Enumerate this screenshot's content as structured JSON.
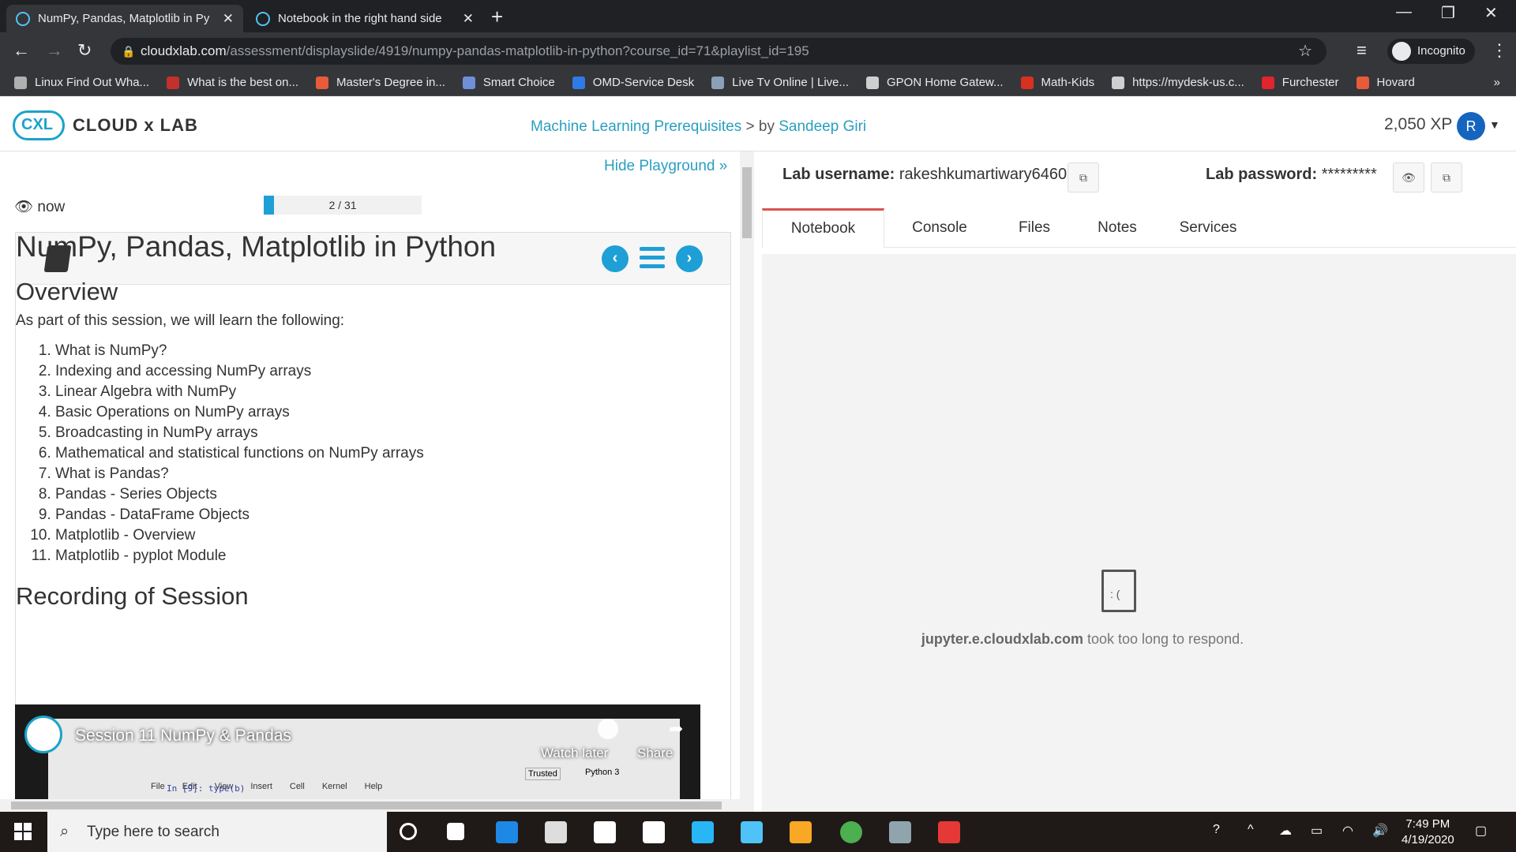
{
  "browser": {
    "tabs": [
      {
        "title": "NumPy, Pandas, Matplotlib in Py",
        "active": true
      },
      {
        "title": "Notebook in the right hand side",
        "active": false
      }
    ],
    "url_host": "cloudxlab.com",
    "url_path": "/assessment/displayslide/4919/numpy-pandas-matplotlib-in-python?course_id=71&playlist_id=195",
    "incognito_label": "Incognito",
    "bookmarks": [
      {
        "label": "Linux Find Out Wha...",
        "color": "#b0b0b0"
      },
      {
        "label": "What is the best on...",
        "color": "#c4302b"
      },
      {
        "label": "Master's Degree in...",
        "color": "#e85b3a"
      },
      {
        "label": "Smart Choice",
        "color": "#6f8fd8"
      },
      {
        "label": "OMD-Service Desk",
        "color": "#2f7be5"
      },
      {
        "label": "Live Tv Online | Live...",
        "color": "#8aa0b8"
      },
      {
        "label": "GPON Home Gatew...",
        "color": "#cfcfcf"
      },
      {
        "label": "Math-Kids",
        "color": "#d9301f"
      },
      {
        "label": "https://mydesk-us.c...",
        "color": "#cfcfcf"
      },
      {
        "label": "Furchester",
        "color": "#e0252e"
      },
      {
        "label": "Hovard",
        "color": "#e85b3a"
      }
    ]
  },
  "header": {
    "logo_text": "CLOUD x LAB",
    "logo_mark": "CXL",
    "course": "Machine Learning Prerequisites",
    "separator": " > by ",
    "author": "Sandeep Giri",
    "xp": "2,050 XP",
    "avatar": "R"
  },
  "left": {
    "hide_playground": "Hide Playground »",
    "views": "now",
    "progress_label": "2 / 31",
    "progress_fraction": 0.065,
    "title": "NumPy, Pandas, Matplotlib in Python",
    "overview_heading": "Overview",
    "intro": "As part of this session, we will learn the following:",
    "items": [
      "What is NumPy?",
      "Indexing and accessing NumPy arrays",
      "Linear Algebra with NumPy",
      "Basic Operations on NumPy arrays",
      "Broadcasting in NumPy arrays",
      "Mathematical and statistical functions on NumPy arrays",
      "What is Pandas?",
      "Pandas - Series Objects",
      "Pandas - DataFrame Objects",
      "Matplotlib - Overview",
      "Matplotlib - pyplot Module"
    ],
    "recording_heading": "Recording of Session",
    "video": {
      "title": "Session 11 NumPy & Pandas",
      "watch_later": "Watch later",
      "share": "Share",
      "menu": [
        "File",
        "Edit",
        "View",
        "Insert",
        "Cell",
        "Kernel",
        "Help"
      ],
      "trusted": "Trusted",
      "kernel": "Python 3",
      "code": "In [9]:  type(b)"
    }
  },
  "right": {
    "username_label": "Lab username:",
    "username": "rakeshkumartiwary6460",
    "password_label": "Lab password:",
    "password": "*********",
    "tabs": [
      "Notebook",
      "Console",
      "Files",
      "Notes",
      "Services"
    ],
    "error_host": "jupyter.e.cloudxlab.com",
    "error_text": " took too long to respond."
  },
  "taskbar": {
    "search_placeholder": "Type here to search",
    "time": "7:49 PM",
    "date": "4/19/2020"
  }
}
